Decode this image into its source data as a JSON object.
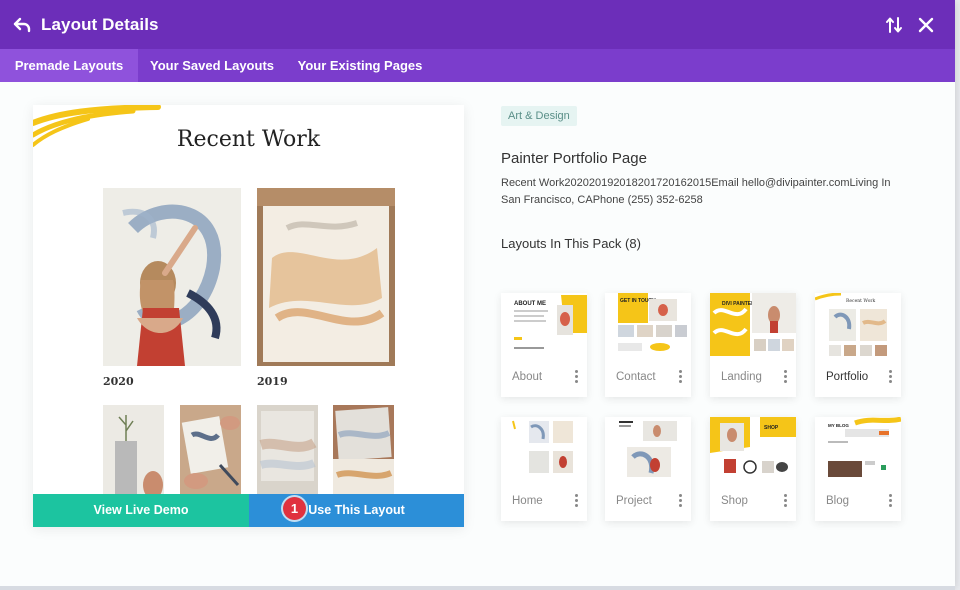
{
  "header": {
    "title": "Layout Details"
  },
  "tabs": [
    {
      "label": "Premade Layouts",
      "active": true
    },
    {
      "label": "Your Saved Layouts",
      "active": false
    },
    {
      "label": "Your Existing Pages",
      "active": false
    }
  ],
  "preview": {
    "title": "Recent Work",
    "years": [
      "2020",
      "2019"
    ],
    "buttons": {
      "demo": "View Live Demo",
      "use": "Use This Layout"
    },
    "step_marker": "1"
  },
  "details": {
    "category": "Art & Design",
    "name": "Painter Portfolio Page",
    "description": "Recent Work2020201920182017201620​15Email hello@divipainter.comLiving In San Francisco, CAPhone (255) 352-6258",
    "pack_title": "Layouts In This Pack (8)"
  },
  "pack": [
    {
      "label": "About",
      "active": false,
      "thumb_text": "ABOUT ME"
    },
    {
      "label": "Contact",
      "active": false,
      "thumb_text": "GET IN TOUCH"
    },
    {
      "label": "Landing",
      "active": false,
      "thumb_text": "DIVI PAINTER"
    },
    {
      "label": "Portfolio",
      "active": true,
      "thumb_text": "Recent Work"
    },
    {
      "label": "Home",
      "active": false,
      "thumb_text": ""
    },
    {
      "label": "Project",
      "active": false,
      "thumb_text": ""
    },
    {
      "label": "Shop",
      "active": false,
      "thumb_text": "SHOP"
    },
    {
      "label": "Blog",
      "active": false,
      "thumb_text": "MY BLOG"
    }
  ],
  "colors": {
    "header": "#6c2eb9",
    "tabs": "#7b3dcc",
    "active_tab": "#8f52dc",
    "demo_button": "#1cc4a0",
    "use_button": "#2c8fd8",
    "step_badge": "#e0323f",
    "accent_yellow": "#f5c518"
  },
  "icons": {
    "back": "undo-arrow-icon",
    "sort": "sort-arrows-icon",
    "close": "close-icon",
    "card_menu": "vertical-dots-icon"
  }
}
